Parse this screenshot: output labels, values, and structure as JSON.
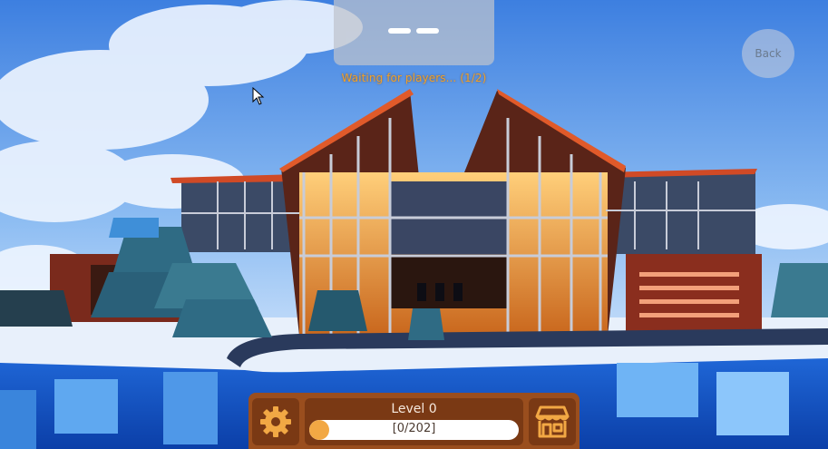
{
  "status": {
    "waiting_text": "Waiting for players... (1/2)"
  },
  "nav": {
    "back_label": "Back"
  },
  "hud": {
    "level_label": "Level 0",
    "xp_text": "[0/202]",
    "xp_progress": 0.0,
    "settings_icon": "gear-icon",
    "shop_icon": "shop-icon"
  },
  "colors": {
    "accent_orange": "#f0a12a",
    "hud_brown": "#9a4e1e",
    "hud_dark_brown": "#7a3914",
    "xp_fill": "#f2a844"
  }
}
